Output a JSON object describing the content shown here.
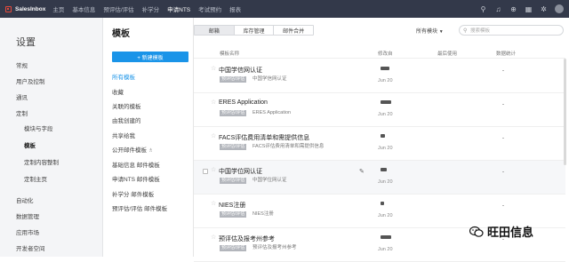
{
  "topbar": {
    "brand": "SalesInbox",
    "nav": [
      "主页",
      "基本信息",
      "预评估/评估",
      "补学分",
      "申请NTS",
      "考试预约",
      "报表"
    ],
    "active_index": 4,
    "icons": [
      "search-icon",
      "bell-icon",
      "add-icon",
      "calendar-icon",
      "settings-icon",
      "avatar"
    ]
  },
  "sidebar": {
    "title": "设置",
    "items": [
      {
        "label": "常规",
        "level": 0
      },
      {
        "label": "用户及控制",
        "level": 0
      },
      {
        "label": "通讯",
        "level": 0
      },
      {
        "label": "定制",
        "level": 0
      },
      {
        "label": "模块与字段",
        "level": 1
      },
      {
        "label": "模板",
        "level": 1,
        "active": true
      },
      {
        "label": "定制内容整制",
        "level": 1
      },
      {
        "label": "定制主页",
        "level": 1
      },
      {
        "label": "自动化",
        "level": 0
      },
      {
        "label": "数据管理",
        "level": 0
      },
      {
        "label": "应用市场",
        "level": 0
      },
      {
        "label": "开发者空间",
        "level": 0
      }
    ]
  },
  "panel": {
    "title": "模板",
    "new_button": "+ 新建模板",
    "items": [
      "所有模板",
      "收藏",
      "关联的模板",
      "由我创建的",
      "共享给我",
      "公开邮件模板",
      "基础信息 邮件模板",
      "申请NTS 邮件模板",
      "补学分 邮件模板",
      "预评估/评估 邮件模板"
    ],
    "active_index": 0
  },
  "main": {
    "tabs": [
      "邮箱",
      "库存管理",
      "邮件合并"
    ],
    "active_tab": 0,
    "filter_label": "所有模块",
    "search_placeholder": "搜索模板",
    "columns": [
      "模板名称",
      "修改自",
      "最后使用",
      "数据统计"
    ],
    "rows": [
      {
        "name": "中国学信网认证",
        "tag": "预评估/评估",
        "subject": "中国学信网认证",
        "modified_date": "Jun 20",
        "stat": "-",
        "bar": 10
      },
      {
        "name": "ERES Application",
        "tag": "预评估/评估",
        "subject": "ERES Application",
        "modified_date": "Jun 20",
        "stat": "-",
        "bar": 12
      },
      {
        "name": "FACS评估费用清单和需提供信息",
        "tag": "预评估/评估",
        "subject": "FACS评估费用清单和需提供信息",
        "modified_date": "Jun 20",
        "stat": "-",
        "bar": 5
      },
      {
        "name": "中国学位网认证",
        "tag": "预评估/评估",
        "subject": "中国学位网认证",
        "modified_date": "Jun 20",
        "stat": "-",
        "bar": 7,
        "hover": true
      },
      {
        "name": "NIES注册",
        "tag": "预评估/评估",
        "subject": "NIES注册",
        "modified_date": "Jun 20",
        "stat": "-",
        "bar": 4
      },
      {
        "name": "预评估及报考州参考",
        "tag": "预评估/评估",
        "subject": "预评估及报考州参考",
        "modified_date": "Jun 20",
        "stat": "-",
        "bar": 12
      }
    ]
  },
  "watermark": "旺田信息"
}
